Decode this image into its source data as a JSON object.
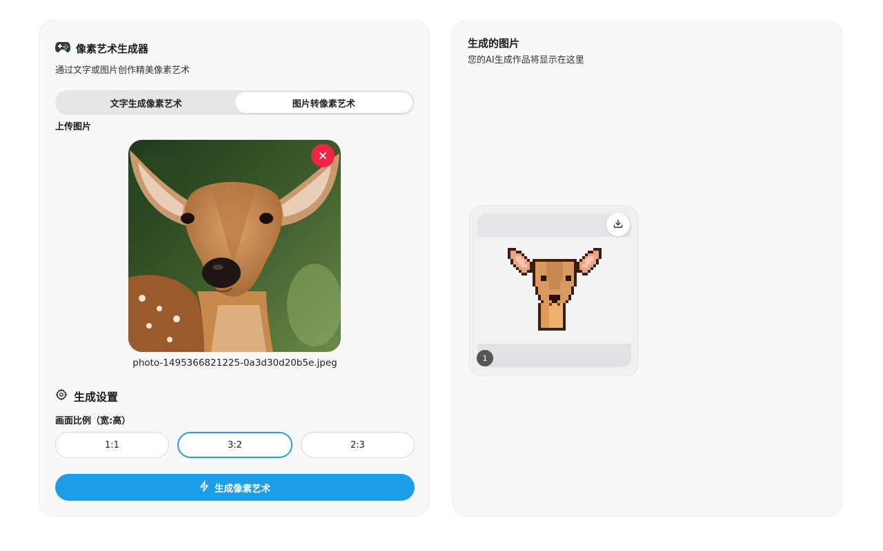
{
  "generator": {
    "title": "像素艺术生成器",
    "subtitle": "通过文字或图片创作精美像素艺术",
    "icon": "gamepad-icon"
  },
  "tabs": [
    {
      "label": "文字生成像素艺术",
      "active": false
    },
    {
      "label": "图片转像素艺术",
      "active": true
    }
  ],
  "upload": {
    "label": "上传图片",
    "filename": "photo-1495366821225-0a3d30d20b5e.jpeg"
  },
  "settings": {
    "title": "生成设置",
    "ratio_label": "画面比例（宽:高）",
    "ratios": [
      {
        "label": "1:1",
        "selected": false
      },
      {
        "label": "3:2",
        "selected": true
      },
      {
        "label": "2:3",
        "selected": false
      }
    ]
  },
  "generate_button": {
    "label": "生成像素艺术"
  },
  "results": {
    "title": "生成的图片",
    "subtitle": "您的AI生成作品将显示在这里",
    "items": [
      {
        "index": "1"
      }
    ]
  },
  "colors": {
    "accent": "#1e9ee8",
    "remove": "#ee2547",
    "panel_bg": "#f8f8f8"
  }
}
